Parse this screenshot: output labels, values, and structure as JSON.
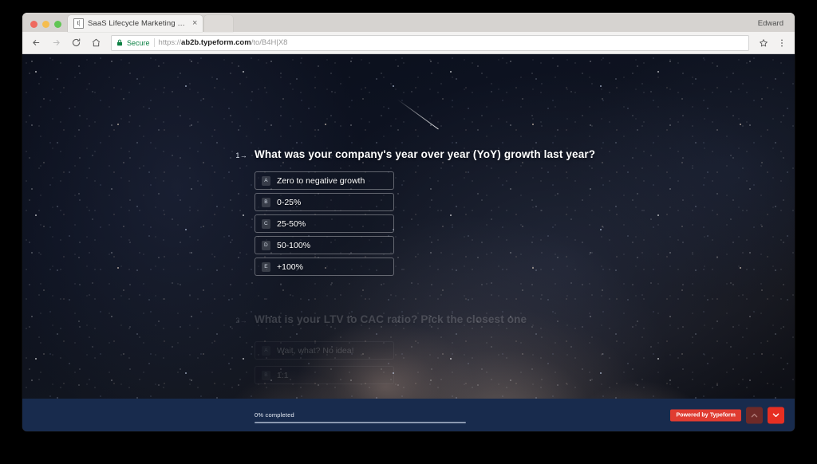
{
  "browser": {
    "tab": {
      "favicon": "typeform-favicon",
      "title": "SaaS Lifecycle Marketing Grad",
      "close_label": "×"
    },
    "profile_name": "Edward",
    "toolbar": {
      "back_icon": "back-arrow-icon",
      "forward_icon": "forward-arrow-icon",
      "reload_icon": "reload-icon",
      "home_icon": "home-icon",
      "star_icon": "star-icon",
      "menu_icon": "three-dot-menu-icon"
    },
    "omnibox": {
      "lock_icon": "lock-icon",
      "secure_label": "Secure",
      "url_scheme": "https://",
      "url_host": "ab2b.typeform.com",
      "url_path": "/to/B4H|X8"
    }
  },
  "form": {
    "current_question": {
      "number": "1",
      "arrow": "→",
      "text": "What was your company's year over year (YoY) growth last year?",
      "options": [
        {
          "key": "A",
          "label": "Zero to negative growth"
        },
        {
          "key": "B",
          "label": "0-25%"
        },
        {
          "key": "C",
          "label": "25-50%"
        },
        {
          "key": "D",
          "label": "50-100%"
        },
        {
          "key": "E",
          "label": "+100%"
        }
      ]
    },
    "next_question": {
      "number": "2",
      "arrow": "→",
      "text": "What is your LTV to CAC ratio? Pick the closest one",
      "options": [
        {
          "key": "A",
          "label": "Wait, what? No idea!"
        },
        {
          "key": "B",
          "label": "1:1"
        }
      ]
    }
  },
  "footer": {
    "progress_label": "0% completed",
    "progress_percent": 0,
    "powered_by": "Powered by Typeform",
    "nav_up_icon": "chevron-up-icon",
    "nav_down_icon": "chevron-down-icon"
  },
  "colors": {
    "accent_red": "#e62f22",
    "footer_navy": "#182b4d",
    "secure_green": "#0b8043"
  }
}
